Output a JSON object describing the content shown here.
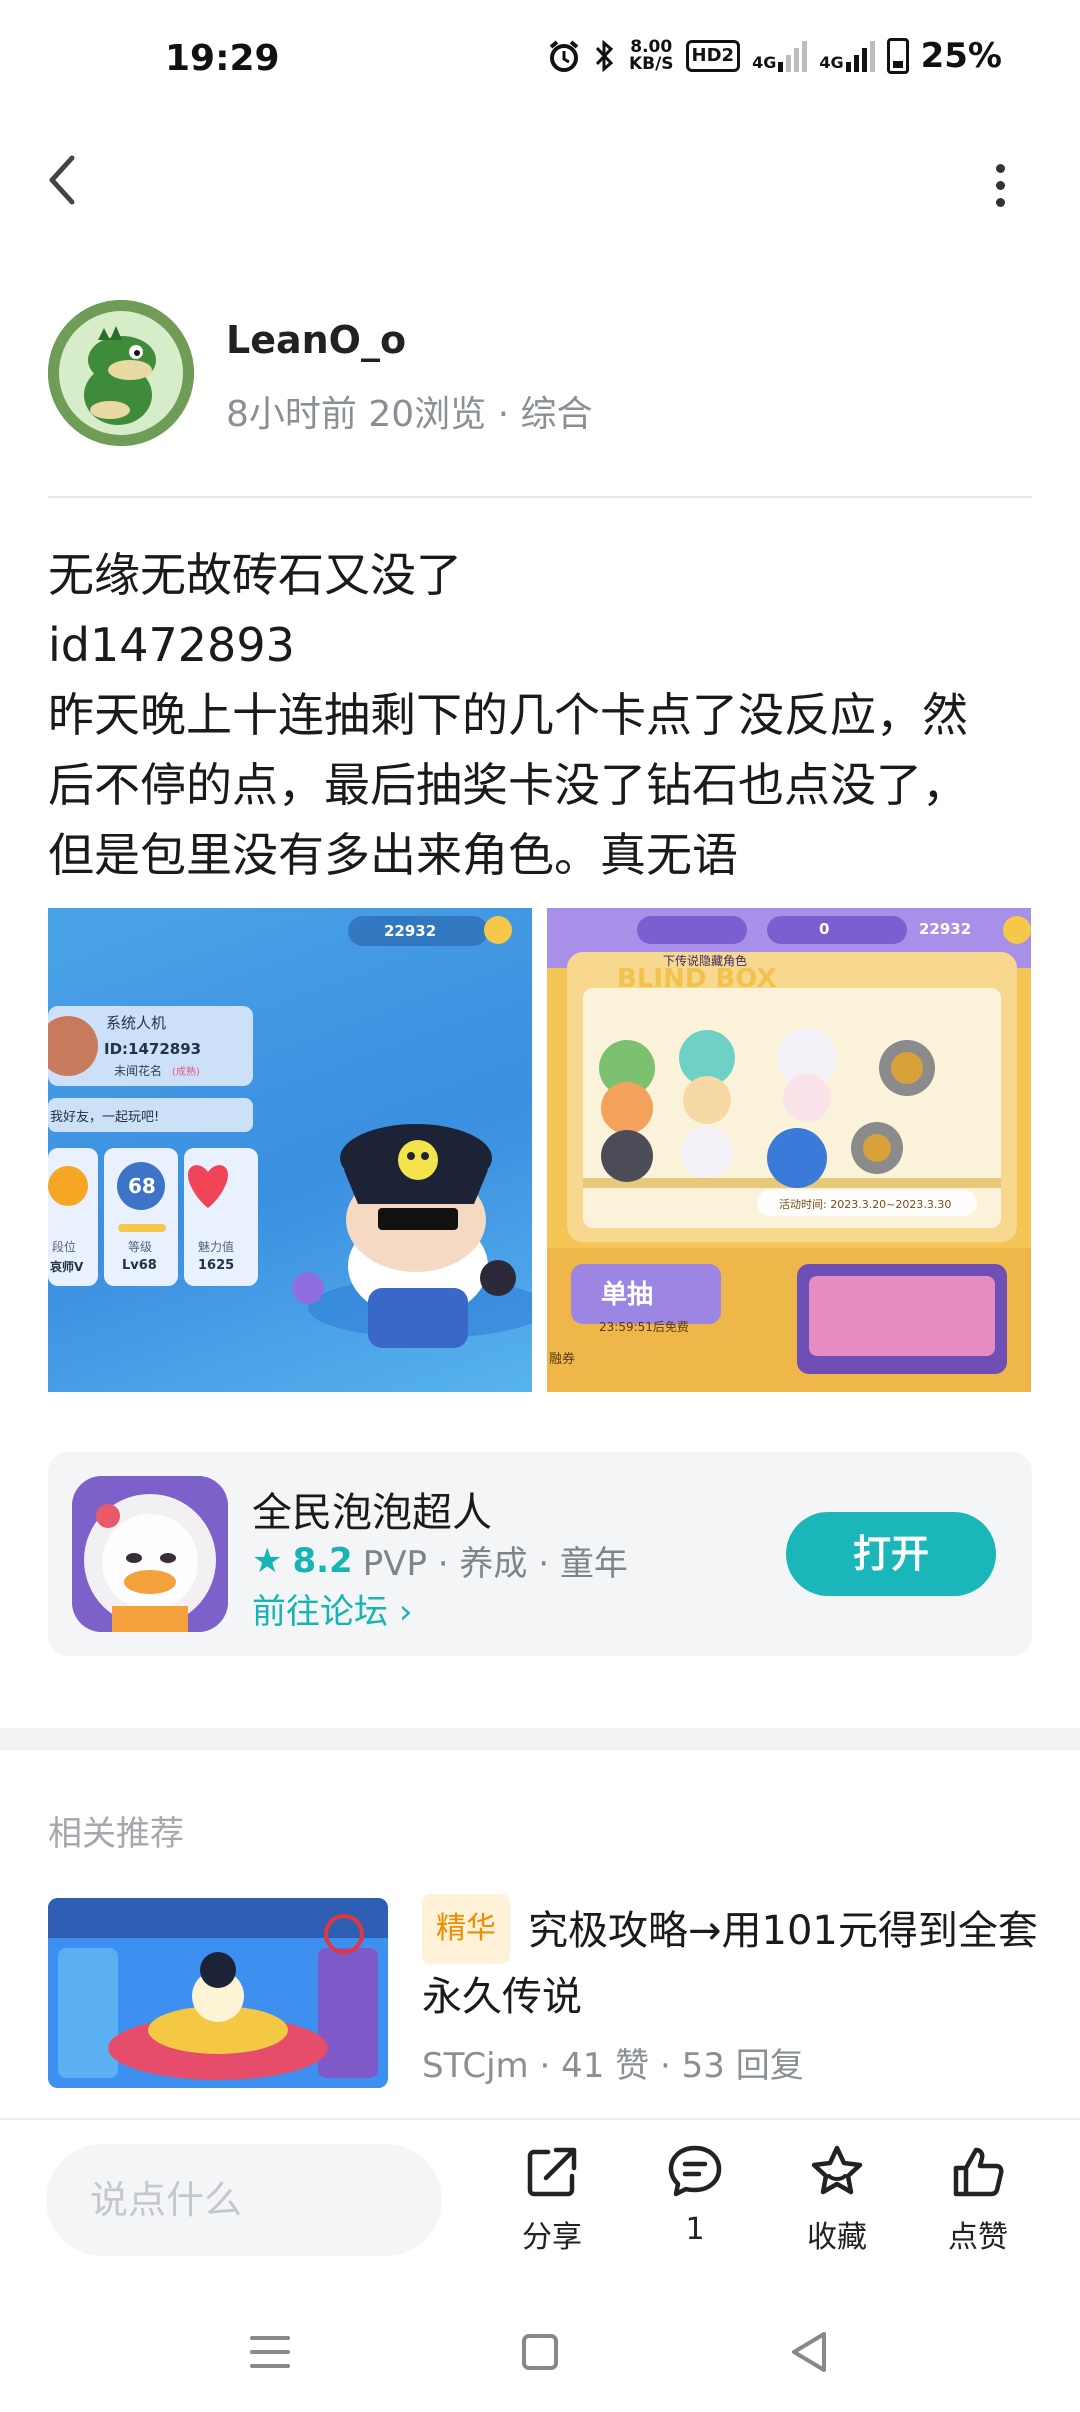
{
  "status_bar": {
    "time": "19:29",
    "net_speed_value": "8.00",
    "net_speed_unit": "KB/S",
    "hd_label": "HD2",
    "signal1_label": "4G",
    "signal2_label": "4G",
    "battery": "25%"
  },
  "nav": {
    "back_icon": "chevron-left-icon",
    "more_icon": "more-vertical-icon"
  },
  "author": {
    "name": "LeanO_o",
    "time_ago": "8小时前",
    "views": "20浏览",
    "category": "综合"
  },
  "post": {
    "lines": [
      "无缘无故砖石又没了",
      "id1472893",
      "昨天晚上十连抽剩下的几个卡点了没反应，然",
      "后不停的点，最后抽奖卡没了钻石也点没了，",
      "但是包里没有多出来角色。真无语"
    ],
    "images": [
      {
        "name": "screenshot-profile",
        "balance": "22932",
        "profile_name": "系统人机",
        "profile_id": "ID:1472893",
        "profile_status": "未闻花名",
        "profile_status_tag": "(成熟)",
        "greeting": "我好友，一起玩吧!",
        "stat_level_number": "68",
        "stat_labels": [
          "段位",
          "等级",
          "魅力值"
        ],
        "stat_values": [
          "哀师V",
          "Lv68",
          "1625"
        ]
      },
      {
        "name": "screenshot-blind-box",
        "balance_left": "0",
        "balance_right": "22932",
        "banner": "BLIND BOX",
        "banner_sub": "下传说隐藏角色",
        "event_time": "活动时间: 2023.3.20~2023.3.30",
        "draw_button": "单抽",
        "free_timer": "23:59:51后免费",
        "side_label": "融券"
      }
    ]
  },
  "app_card": {
    "name": "全民泡泡超人",
    "rating": "8.2",
    "tags": "PVP · 养成 · 童年",
    "forum_link": "前往论坛",
    "open_button": "打开"
  },
  "related": {
    "section_title": "相关推荐",
    "items": [
      {
        "badge": "精华",
        "title": "究极攻略→用101元得到全套永久传说",
        "author": "STCjm",
        "likes": "41 赞",
        "replies": "53 回复"
      }
    ]
  },
  "action_bar": {
    "comment_placeholder": "说点什么",
    "share_label": "分享",
    "comment_count": "1",
    "favorite_label": "收藏",
    "like_label": "点赞"
  },
  "colors": {
    "accent": "#1ab6b9",
    "badge_bg": "#fff2d9",
    "badge_text": "#f08c00",
    "meta_gray": "#8a8f95"
  }
}
